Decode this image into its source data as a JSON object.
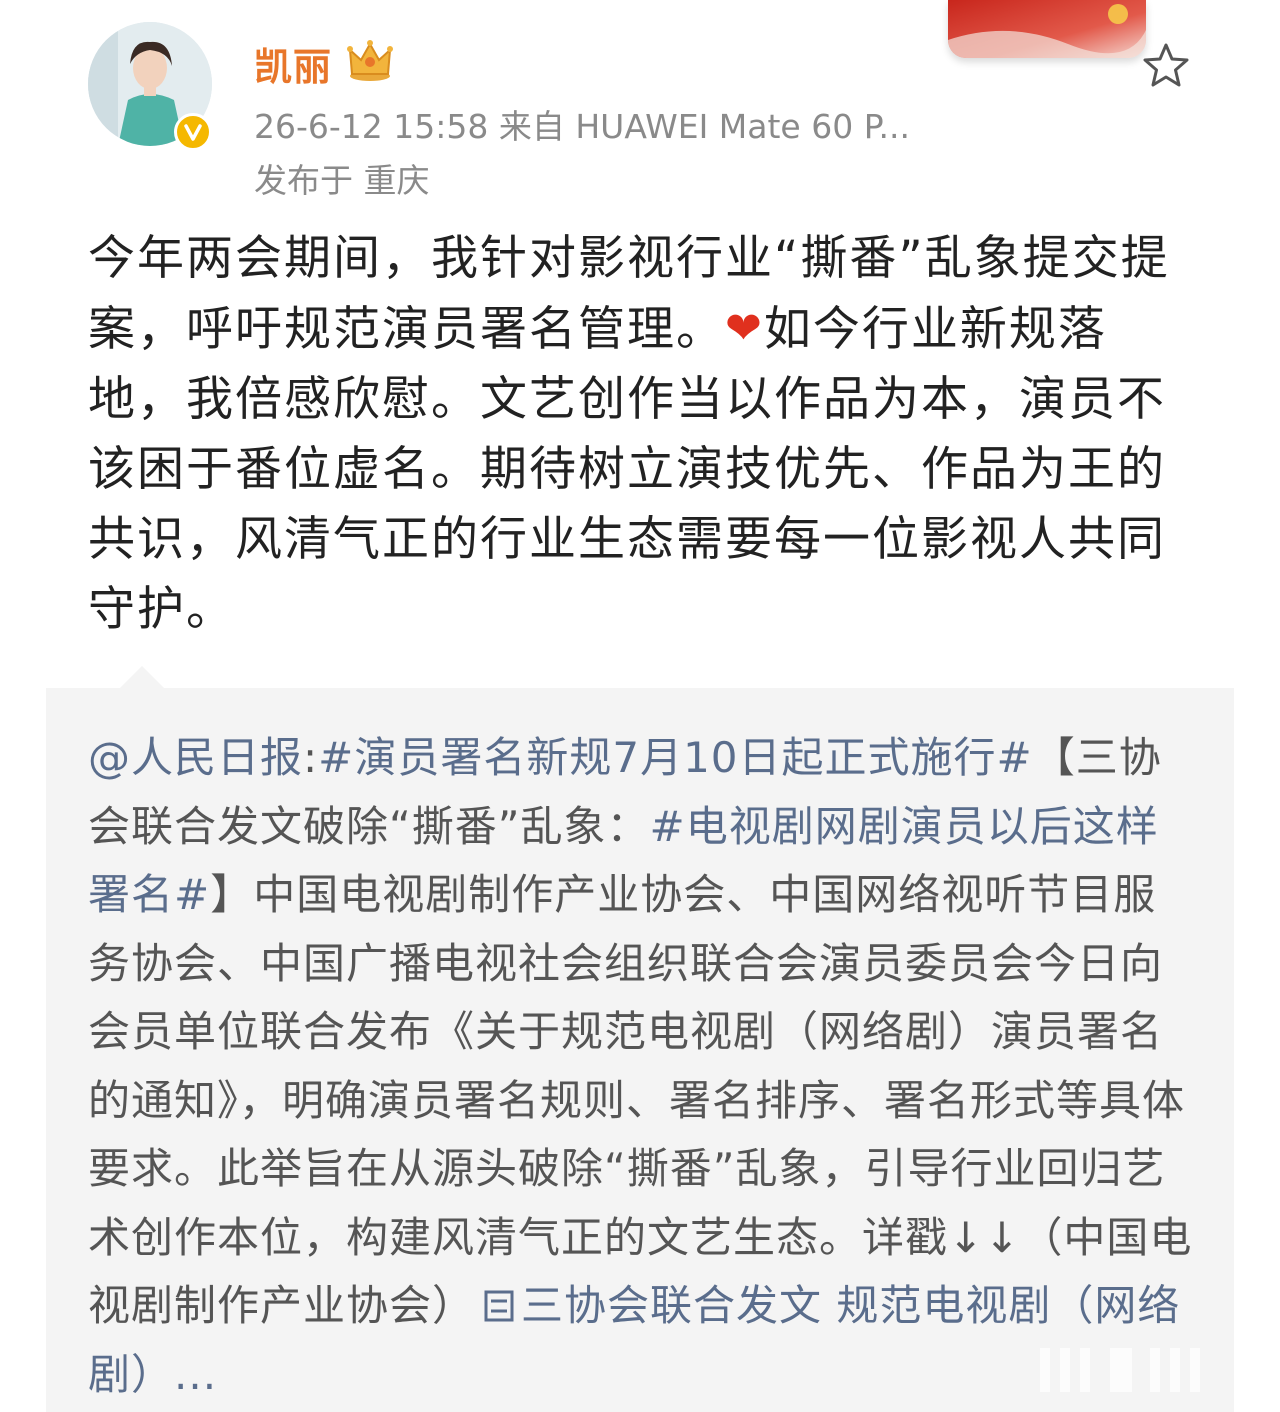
{
  "user": {
    "name": "凯丽",
    "avatar_icon": "avatar-portrait",
    "badge_icon": "crown-icon",
    "verified_icon": "verified-v-icon"
  },
  "post_meta": {
    "time_source": "26-6-12 15:58  来自 HUAWEI Mate 60 P...",
    "location": "发布于 重庆"
  },
  "post_body": {
    "part1": "今年两会期间，我针对影视行业“撕番”乱象提交提案，呼吁规范演员署名管理。",
    "heart": "❤",
    "part2": "如今行业新规落地，我倍感欣慰。文艺创作当以作品为本，演员不该困于番位虚名。期待树立演技优先、作品为王的共识，风清气正的行业生态需要每一位影视人共同守护。"
  },
  "repost": {
    "author_link": "@人民日报",
    "colon": ":",
    "topic1": "#演员署名新规7月10日起正式施行#",
    "title_part": "【三协会联合发文破除“撕番”乱象：",
    "topic2": "#电视剧网剧演员以后这样署名#",
    "close_bracket": "】",
    "body": "中国电视剧制作产业协会、中国网络视听节目服务协会、中国广播电视社会组织联合会演员委员会今日向会员单位联合发布《关于规范电视剧（网络剧）演员署名的通知》，明确演员署名规则、署名排序、署名形式等具体要求。此举旨在从源头破除“撕番”乱象，引导行业回归艺术创作本位，构建风清气正的文艺生态。详戳↓↓（中国电视剧制作产业协会）",
    "web_icon": "web-link-icon",
    "web_link": "三协会联合发文 规范电视剧（网络剧）..."
  },
  "colors": {
    "username": "#e8762a",
    "meta": "#8a8a8a",
    "link": "#5a6d8c",
    "repost_bg": "#f4f4f4"
  }
}
